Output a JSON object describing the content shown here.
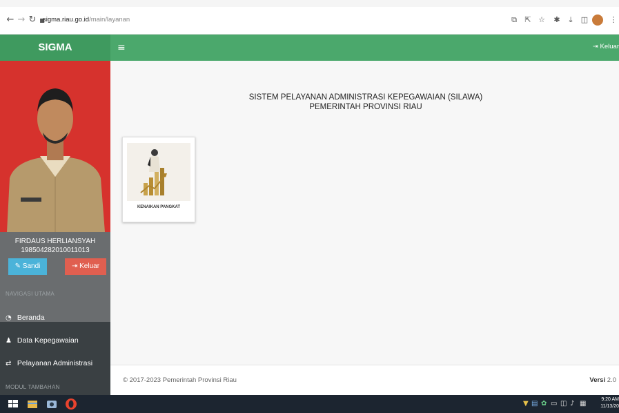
{
  "browser": {
    "url_host": "sigma.riau.go.id",
    "url_path": "/main/layanan"
  },
  "header": {
    "brand": "SIGMA",
    "menu_icon": "hamburger-icon",
    "logout_label": "Keluar"
  },
  "profile": {
    "name": "FIRDAUS HERLIANSYAH",
    "nip": "198504282010011013",
    "password_button": "Sandi",
    "logout_button": "Keluar"
  },
  "sidebar": {
    "section_main": "NAVIGASI UTAMA",
    "items": [
      {
        "label": "Beranda",
        "icon": "dashboard-icon"
      },
      {
        "label": "Data Kepegawaian",
        "icon": "user-icon"
      },
      {
        "label": "Pelayanan Administrasi",
        "icon": "retweet-icon"
      }
    ],
    "section_extra": "MODUL TAMBAHAN"
  },
  "main": {
    "title_line1": "SISTEM PELAYANAN ADMINISTRASI KEPEGAWAIAN (SILAWA)",
    "title_line2": "PEMERINTAH PROVINSI RIAU",
    "cards": [
      {
        "label": "KENAIKAN PANGKAT"
      }
    ]
  },
  "footer": {
    "copyright": "© 2017-2023 Pemerintah Provinsi Riau",
    "version_label": "Versi",
    "version_number": "2.0"
  },
  "taskbar": {
    "time": "9:20 AM",
    "date": "11/13/20"
  },
  "colors": {
    "header_green": "#4ba86c",
    "sidebar_dark": "#3a4043",
    "photo_red": "#d6322d",
    "button_blue": "#4bb3d9",
    "button_red": "#e05f50"
  }
}
